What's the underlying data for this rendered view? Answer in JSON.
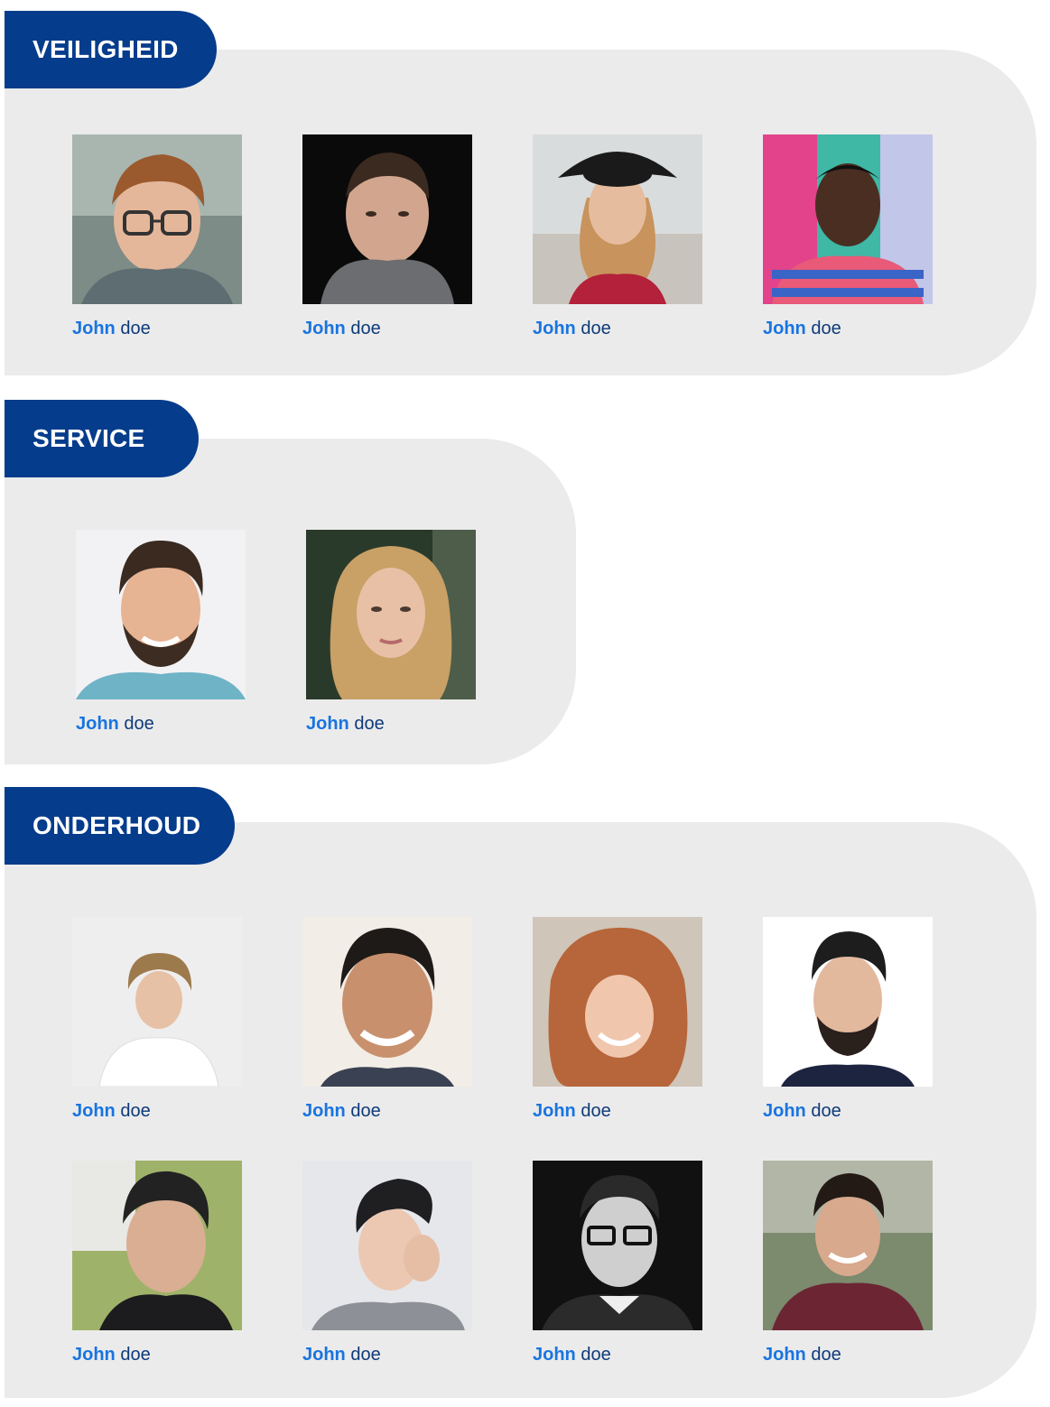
{
  "colors": {
    "tab_background": "#053c8c",
    "panel_background": "#ebebeb",
    "first_name": "#1874e0",
    "last_name": "#0e3a7a"
  },
  "sections": [
    {
      "title": "VEILIGHEID",
      "members": [
        {
          "first": "John",
          "last": "doe",
          "photo": "person-photo"
        },
        {
          "first": "John",
          "last": "doe",
          "photo": "person-photo"
        },
        {
          "first": "John",
          "last": "doe",
          "photo": "person-photo"
        },
        {
          "first": "John",
          "last": "doe",
          "photo": "person-photo"
        }
      ]
    },
    {
      "title": "SERVICE",
      "members": [
        {
          "first": "John",
          "last": "doe",
          "photo": "person-photo"
        },
        {
          "first": "John",
          "last": "doe",
          "photo": "person-photo"
        }
      ]
    },
    {
      "title": "ONDERHOUD",
      "members": [
        {
          "first": "John",
          "last": "doe",
          "photo": "person-photo"
        },
        {
          "first": "John",
          "last": "doe",
          "photo": "person-photo"
        },
        {
          "first": "John",
          "last": "doe",
          "photo": "person-photo"
        },
        {
          "first": "John",
          "last": "doe",
          "photo": "person-photo"
        },
        {
          "first": "John",
          "last": "doe",
          "photo": "person-photo"
        },
        {
          "first": "John",
          "last": "doe",
          "photo": "person-photo"
        },
        {
          "first": "John",
          "last": "doe",
          "photo": "person-photo"
        },
        {
          "first": "John",
          "last": "doe",
          "photo": "person-photo"
        }
      ]
    }
  ]
}
